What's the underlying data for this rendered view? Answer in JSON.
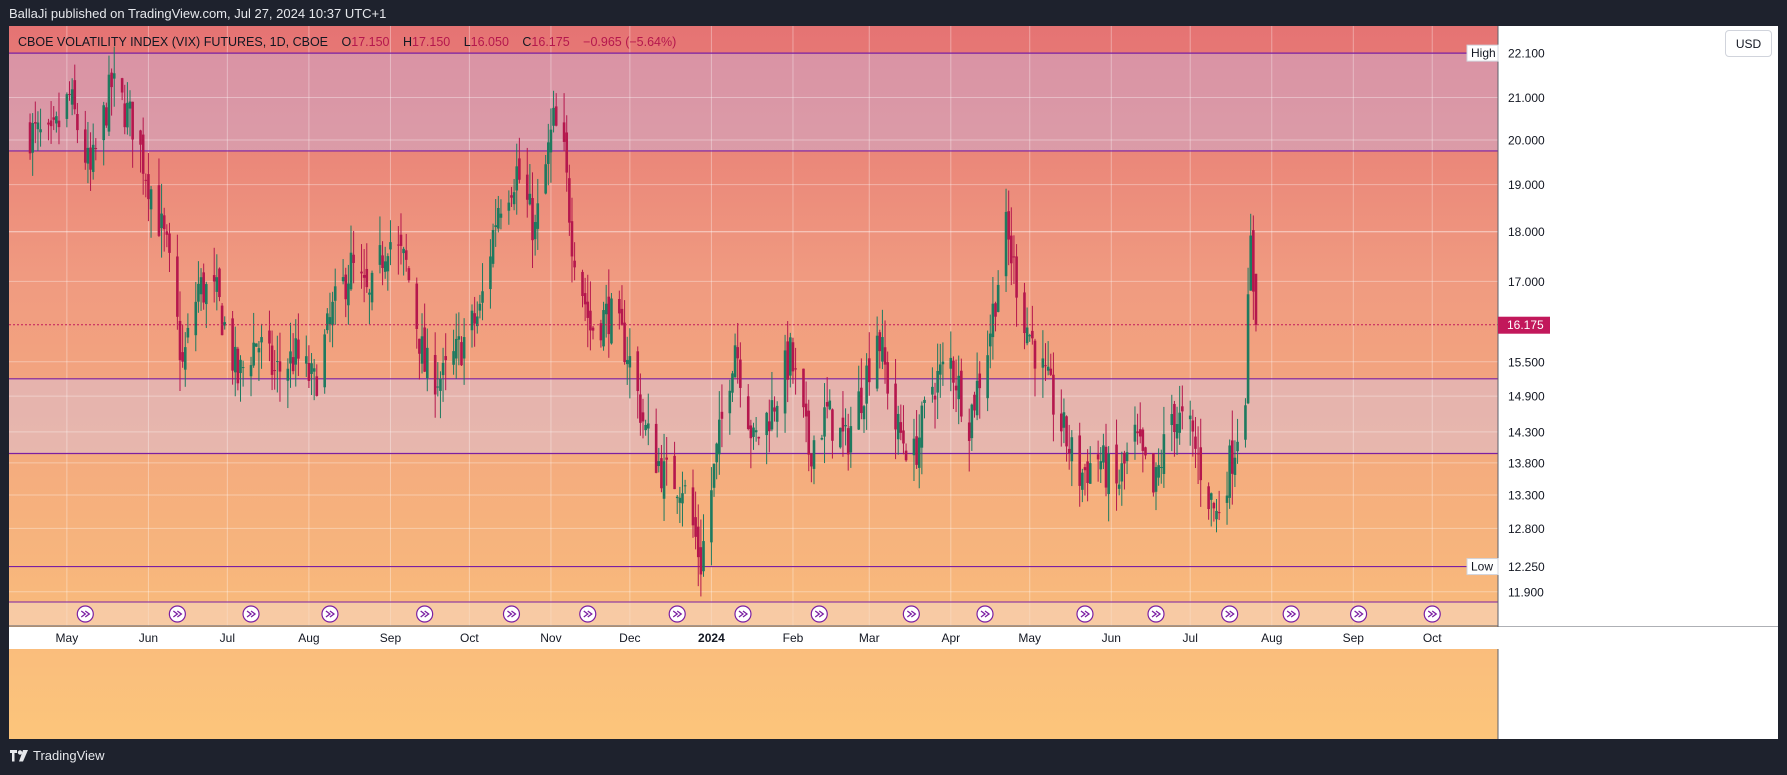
{
  "header": {
    "publisher_line": "BallaJi published on TradingView.com, Jul 27, 2024 10:37 UTC+1"
  },
  "legend": {
    "symbol": "CBOE VOLATILITY INDEX (VIX) FUTURES, 1D, CBOE",
    "open_label": "O",
    "open": "17.150",
    "high_label": "H",
    "high": "17.150",
    "low_label": "L",
    "low": "16.050",
    "close_label": "C",
    "close": "16.175",
    "change": "−0.965 (−5.64%)"
  },
  "currency_button": "USD",
  "footer": {
    "brand": "TradingView"
  },
  "colors": {
    "up_candle": "#1e7a5f",
    "down_candle": "#b5174d",
    "level_line": "#7b1fa2",
    "last_price": "#c2185b"
  },
  "chart_data": {
    "type": "candlestick",
    "x_ticks": [
      "May",
      "Jun",
      "Jul",
      "Aug",
      "Sep",
      "Oct",
      "Nov",
      "Dec",
      "2024",
      "Feb",
      "Mar",
      "Apr",
      "May",
      "Jun",
      "Jul",
      "Aug",
      "Sep",
      "Oct"
    ],
    "y_ticks": [
      "11.900",
      "12.800",
      "13.300",
      "13.800",
      "14.300",
      "14.900",
      "15.500",
      "17.000",
      "18.000",
      "19.000",
      "20.000",
      "21.000"
    ],
    "ylim": [
      11.6,
      22.8
    ],
    "scale": "log",
    "horizontal_levels": [
      22.1,
      19.75,
      15.2,
      13.95,
      12.25
    ],
    "high_marker": {
      "label": "High",
      "value": "22.100"
    },
    "low_marker": {
      "label": "Low",
      "value": "12.250"
    },
    "last_price": {
      "value": "16.175"
    },
    "x_range_months": [
      "2023-04",
      "2024-10"
    ],
    "close_path": [
      [
        "2023-04-17",
        20.2
      ],
      [
        "2023-04-25",
        19.9
      ],
      [
        "2023-05-02",
        21.0
      ],
      [
        "2023-05-10",
        19.2
      ],
      [
        "2023-05-18",
        21.3
      ],
      [
        "2023-05-26",
        20.4
      ],
      [
        "2023-06-02",
        18.9
      ],
      [
        "2023-06-08",
        17.6
      ],
      [
        "2023-06-14",
        15.4
      ],
      [
        "2023-06-20",
        16.9
      ],
      [
        "2023-06-27",
        16.7
      ],
      [
        "2023-07-05",
        15.2
      ],
      [
        "2023-07-12",
        15.9
      ],
      [
        "2023-07-19",
        15.3
      ],
      [
        "2023-07-27",
        15.6
      ],
      [
        "2023-08-03",
        15.1
      ],
      [
        "2023-08-10",
        16.4
      ],
      [
        "2023-08-17",
        17.3
      ],
      [
        "2023-08-24",
        16.6
      ],
      [
        "2023-08-31",
        17.9
      ],
      [
        "2023-09-07",
        17.3
      ],
      [
        "2023-09-14",
        15.4
      ],
      [
        "2023-09-21",
        15.2
      ],
      [
        "2023-09-28",
        15.8
      ],
      [
        "2023-10-05",
        16.4
      ],
      [
        "2023-10-12",
        18.6
      ],
      [
        "2023-10-19",
        19.3
      ],
      [
        "2023-10-26",
        18.0
      ],
      [
        "2023-11-02",
        20.4
      ],
      [
        "2023-11-06",
        19.6
      ],
      [
        "2023-11-09",
        17.9
      ],
      [
        "2023-11-16",
        16.1
      ],
      [
        "2023-11-23",
        16.4
      ],
      [
        "2023-11-30",
        15.7
      ],
      [
        "2023-12-07",
        14.3
      ],
      [
        "2023-12-14",
        13.6
      ],
      [
        "2023-12-21",
        13.5
      ],
      [
        "2023-12-28",
        12.3
      ],
      [
        "2024-01-04",
        14.2
      ],
      [
        "2024-01-10",
        15.9
      ],
      [
        "2024-01-17",
        14.1
      ],
      [
        "2024-01-24",
        14.7
      ],
      [
        "2024-01-31",
        15.6
      ],
      [
        "2024-02-07",
        14.0
      ],
      [
        "2024-02-14",
        14.6
      ],
      [
        "2024-02-21",
        14.1
      ],
      [
        "2024-02-28",
        15.1
      ],
      [
        "2024-03-04",
        16.1
      ],
      [
        "2024-03-11",
        14.4
      ],
      [
        "2024-03-18",
        13.9
      ],
      [
        "2024-03-25",
        15.1
      ],
      [
        "2024-04-01",
        15.5
      ],
      [
        "2024-04-08",
        14.5
      ],
      [
        "2024-04-15",
        15.8
      ],
      [
        "2024-04-22",
        18.0
      ],
      [
        "2024-04-29",
        16.3
      ],
      [
        "2024-05-06",
        15.3
      ],
      [
        "2024-05-13",
        14.4
      ],
      [
        "2024-05-20",
        13.6
      ],
      [
        "2024-05-27",
        13.9
      ],
      [
        "2024-06-03",
        13.4
      ],
      [
        "2024-06-10",
        14.2
      ],
      [
        "2024-06-17",
        13.3
      ],
      [
        "2024-06-24",
        14.6
      ],
      [
        "2024-07-01",
        14.3
      ],
      [
        "2024-07-08",
        13.3
      ],
      [
        "2024-07-11",
        13.0
      ],
      [
        "2024-07-18",
        14.1
      ],
      [
        "2024-07-22",
        15.1
      ],
      [
        "2024-07-24",
        17.7
      ],
      [
        "2024-07-26",
        16.175
      ]
    ]
  }
}
